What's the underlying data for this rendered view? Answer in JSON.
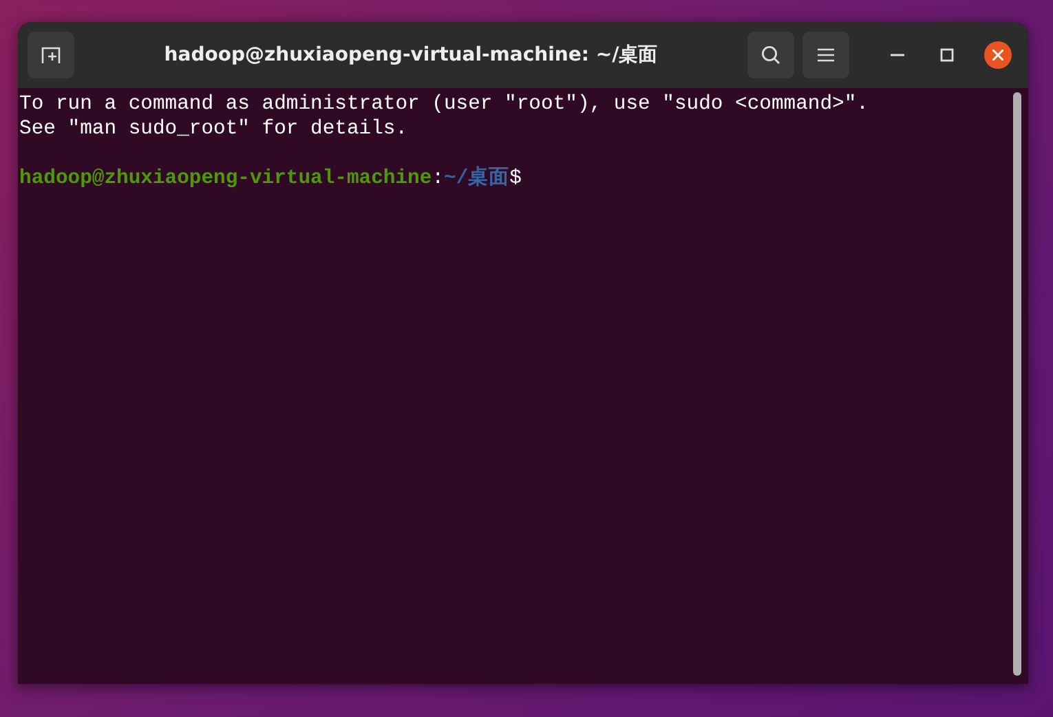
{
  "window": {
    "title": "hadoop@zhuxiaopeng-virtual-machine: ~/桌面"
  },
  "terminal": {
    "lines": [
      {
        "segments": [
          {
            "kind": "plain",
            "text": "To run a command as administrator (user \"root\"), use \"sudo <command>\"."
          }
        ]
      },
      {
        "segments": [
          {
            "kind": "plain",
            "text": "See \"man sudo_root\" for details."
          }
        ]
      },
      {
        "segments": [
          {
            "kind": "user",
            "text": "hadoop@zhuxiaopeng-virtual-machine"
          },
          {
            "kind": "plain",
            "text": ":"
          },
          {
            "kind": "path",
            "text": "~/桌面"
          },
          {
            "kind": "plain",
            "text": "$"
          }
        ]
      }
    ]
  }
}
